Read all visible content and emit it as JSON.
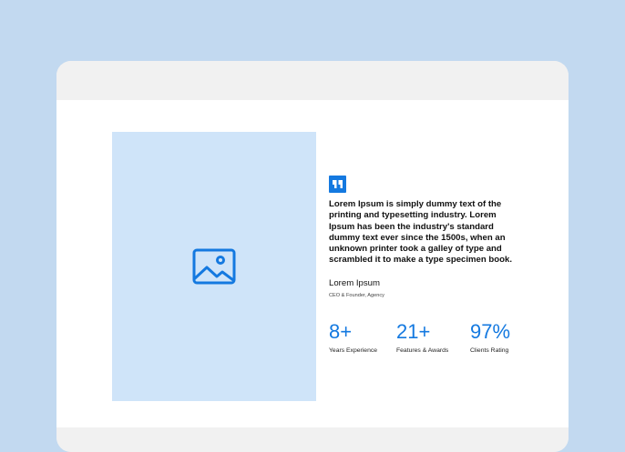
{
  "testimonial": {
    "image_icon": "image-icon",
    "quote_icon": "quote-icon",
    "quote": "Lorem Ipsum is simply dummy text of the printing and typesetting industry. Lorem Ipsum has been the industry's standard dummy text ever since the 1500s, when an unknown printer took a galley of type and scrambled it to make a type specimen book.",
    "author_name": "Lorem Ipsum",
    "author_role": "CEO & Founder, Agency"
  },
  "stats": [
    {
      "value": "8+",
      "label": "Years Experience"
    },
    {
      "value": "21+",
      "label": "Features & Awards"
    },
    {
      "value": "97%",
      "label": "Clients Rating"
    }
  ],
  "colors": {
    "page_background": "#c2d9f0",
    "accent": "#1479e0",
    "image_placeholder": "#cfe4f9",
    "window_chrome": "#f1f1f1"
  }
}
